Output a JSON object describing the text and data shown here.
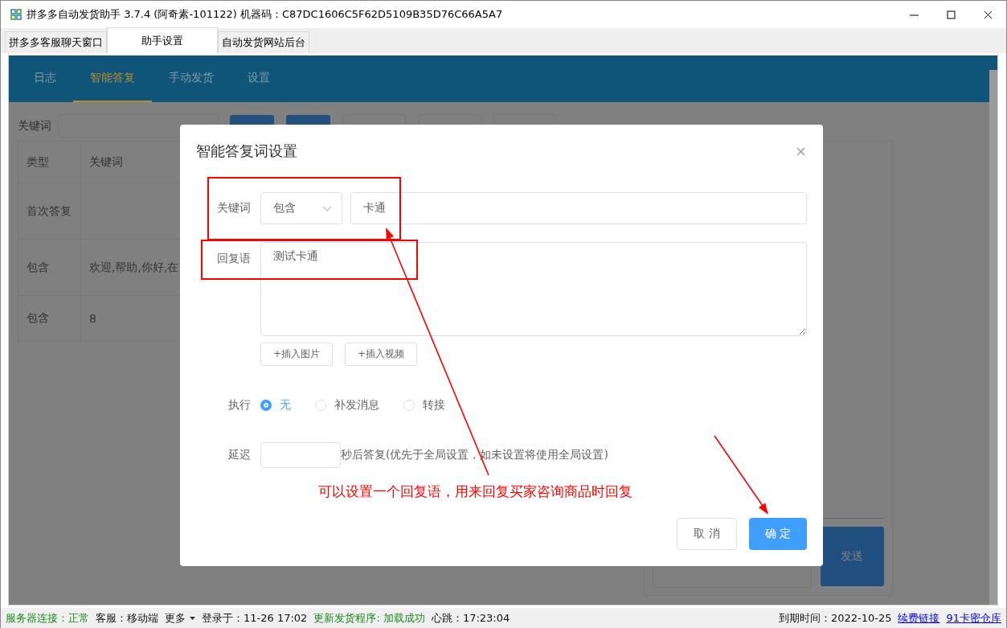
{
  "window": {
    "title": "拼多多自动发货助手 3.7.4 (阿奇素-101122) 机器码：C87DC1606C5F62D5109B35D76C66A5A7"
  },
  "tabs": [
    {
      "label": "拼多多客服聊天窗口",
      "selected": false
    },
    {
      "label": "助手设置",
      "selected": true
    },
    {
      "label": "自动发货网站后台",
      "selected": false
    }
  ],
  "nav": [
    {
      "label": "日志",
      "selected": false
    },
    {
      "label": "智能答复",
      "selected": true
    },
    {
      "label": "手动发货",
      "selected": false
    },
    {
      "label": "设置",
      "selected": false
    }
  ],
  "search": {
    "label": "关键词"
  },
  "toolbar_buttons": [
    {
      "kind": "primary"
    },
    {
      "kind": "primary"
    },
    {
      "kind": "plain"
    },
    {
      "kind": "plain"
    },
    {
      "kind": "plain"
    }
  ],
  "table": {
    "columns": [
      "类型",
      "关键词"
    ],
    "rows": [
      {
        "type": "首次答复"
      },
      {
        "type": "包含",
        "keyword": "欢迎,帮助,你好,在"
      },
      {
        "type": "包含",
        "keyword": "8"
      }
    ]
  },
  "test_panel": {
    "send_button": "发送"
  },
  "dialog": {
    "title": "智能答复词设置",
    "keyword": {
      "label": "关键词",
      "match": "包含",
      "value": "卡通"
    },
    "reply": {
      "label": "回复语",
      "value": "测试卡通"
    },
    "insert_buttons": [
      "+插入图片",
      "+插入视频"
    ],
    "action": {
      "label": "执行",
      "options": [
        {
          "label": "无",
          "selected": true
        },
        {
          "label": "补发消息",
          "selected": false
        },
        {
          "label": "转接",
          "selected": false
        }
      ]
    },
    "delay": {
      "label": "延迟",
      "suffix": "秒后答复(优先于全局设置，如未设置将使用全局设置)"
    },
    "buttons": [
      {
        "label": "取 消",
        "kind": "plain"
      },
      {
        "label": "确 定",
        "kind": "primary"
      }
    ]
  },
  "annotation": {
    "text": "可以设置一个回复语，用来回复买家咨询商品时回复"
  },
  "status_bar": {
    "left": [
      {
        "text": "服务器连接：正常",
        "kind": "ok"
      },
      {
        "text": "客服：移动端",
        "kind": "normal"
      },
      {
        "text": "更多",
        "kind": "dropdown"
      },
      {
        "text": "登录于：11-26 17:02",
        "kind": "normal"
      },
      {
        "text": "更新发货程序: 加载成功",
        "kind": "ok"
      },
      {
        "text": "心跳：17:23:04",
        "kind": "normal"
      }
    ],
    "expiry": "到期时间：2022-10-25",
    "links": [
      "续费链接",
      "91卡密仓库"
    ]
  }
}
